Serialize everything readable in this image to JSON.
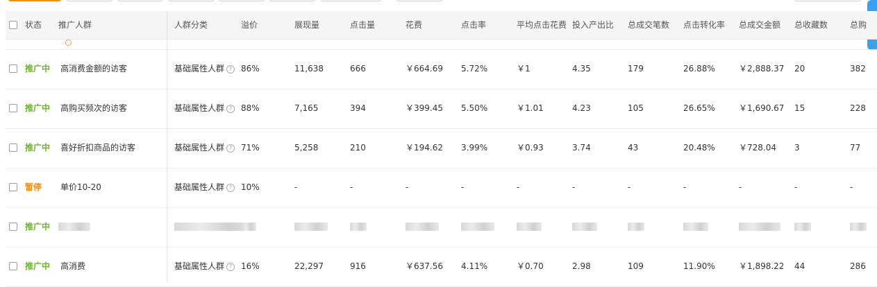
{
  "colors": {
    "active": "#6ab42a",
    "paused": "#ff8a00",
    "header_bg": "#f5f5f5"
  },
  "headers": {
    "status": "状态",
    "crowd": "推广人群",
    "category": "人群分类",
    "premium": "溢价",
    "impressions": "展现量",
    "clicks": "点击量",
    "spend": "花费",
    "ctr": "点击率",
    "avg_cpc": "平均点击花费",
    "roi": "投入产出比",
    "orders": "总成交笔数",
    "cvr": "点击转化率",
    "gmv": "总成交金额",
    "favorites": "总收藏数",
    "cart": "总购"
  },
  "rows": [
    {
      "status": "推广中",
      "status_type": "active",
      "name": "高消费金额的访客",
      "category": "基础属性人群",
      "premium": "86%",
      "impressions": "11,638",
      "clicks": "666",
      "spend": "￥664.69",
      "ctr": "5.72%",
      "avg_cpc": "￥1",
      "roi": "4.35",
      "orders": "179",
      "cvr": "26.88%",
      "gmv": "￥2,888.37",
      "favorites": "20",
      "cart": "382"
    },
    {
      "status": "推广中",
      "status_type": "active",
      "name": "高购买频次的访客",
      "category": "基础属性人群",
      "premium": "88%",
      "impressions": "7,165",
      "clicks": "394",
      "spend": "￥399.45",
      "ctr": "5.50%",
      "avg_cpc": "￥1.01",
      "roi": "4.23",
      "orders": "105",
      "cvr": "26.65%",
      "gmv": "￥1,690.67",
      "favorites": "15",
      "cart": "228"
    },
    {
      "status": "推广中",
      "status_type": "active",
      "name": "喜好折扣商品的访客",
      "category": "基础属性人群",
      "premium": "71%",
      "impressions": "5,258",
      "clicks": "210",
      "spend": "￥194.62",
      "ctr": "3.99%",
      "avg_cpc": "￥0.93",
      "roi": "3.74",
      "orders": "43",
      "cvr": "20.48%",
      "gmv": "￥728.04",
      "favorites": "3",
      "cart": "77"
    },
    {
      "status": "暂停",
      "status_type": "paused",
      "name": "单价10-20",
      "category": "基础属性人群",
      "premium": "10%",
      "impressions": "-",
      "clicks": "-",
      "spend": "-",
      "ctr": "-",
      "avg_cpc": "-",
      "roi": "-",
      "orders": "-",
      "cvr": "-",
      "gmv": "-",
      "favorites": "-",
      "cart": "-"
    },
    {
      "status": "推广中",
      "status_type": "active",
      "name": "",
      "category": "",
      "premium": "",
      "impressions": "",
      "clicks": "",
      "spend": "",
      "ctr": "",
      "avg_cpc": "",
      "roi": "",
      "orders": "",
      "cvr": "",
      "gmv": "",
      "favorites": "",
      "cart": "",
      "blurred": true
    },
    {
      "status": "推广中",
      "status_type": "active",
      "name": "高消费",
      "category": "基础属性人群",
      "premium": "16%",
      "impressions": "22,297",
      "clicks": "916",
      "spend": "￥637.56",
      "ctr": "4.11%",
      "avg_cpc": "￥0.70",
      "roi": "2.98",
      "orders": "109",
      "cvr": "11.90%",
      "gmv": "￥1,898.22",
      "favorites": "44",
      "cart": "286"
    }
  ]
}
